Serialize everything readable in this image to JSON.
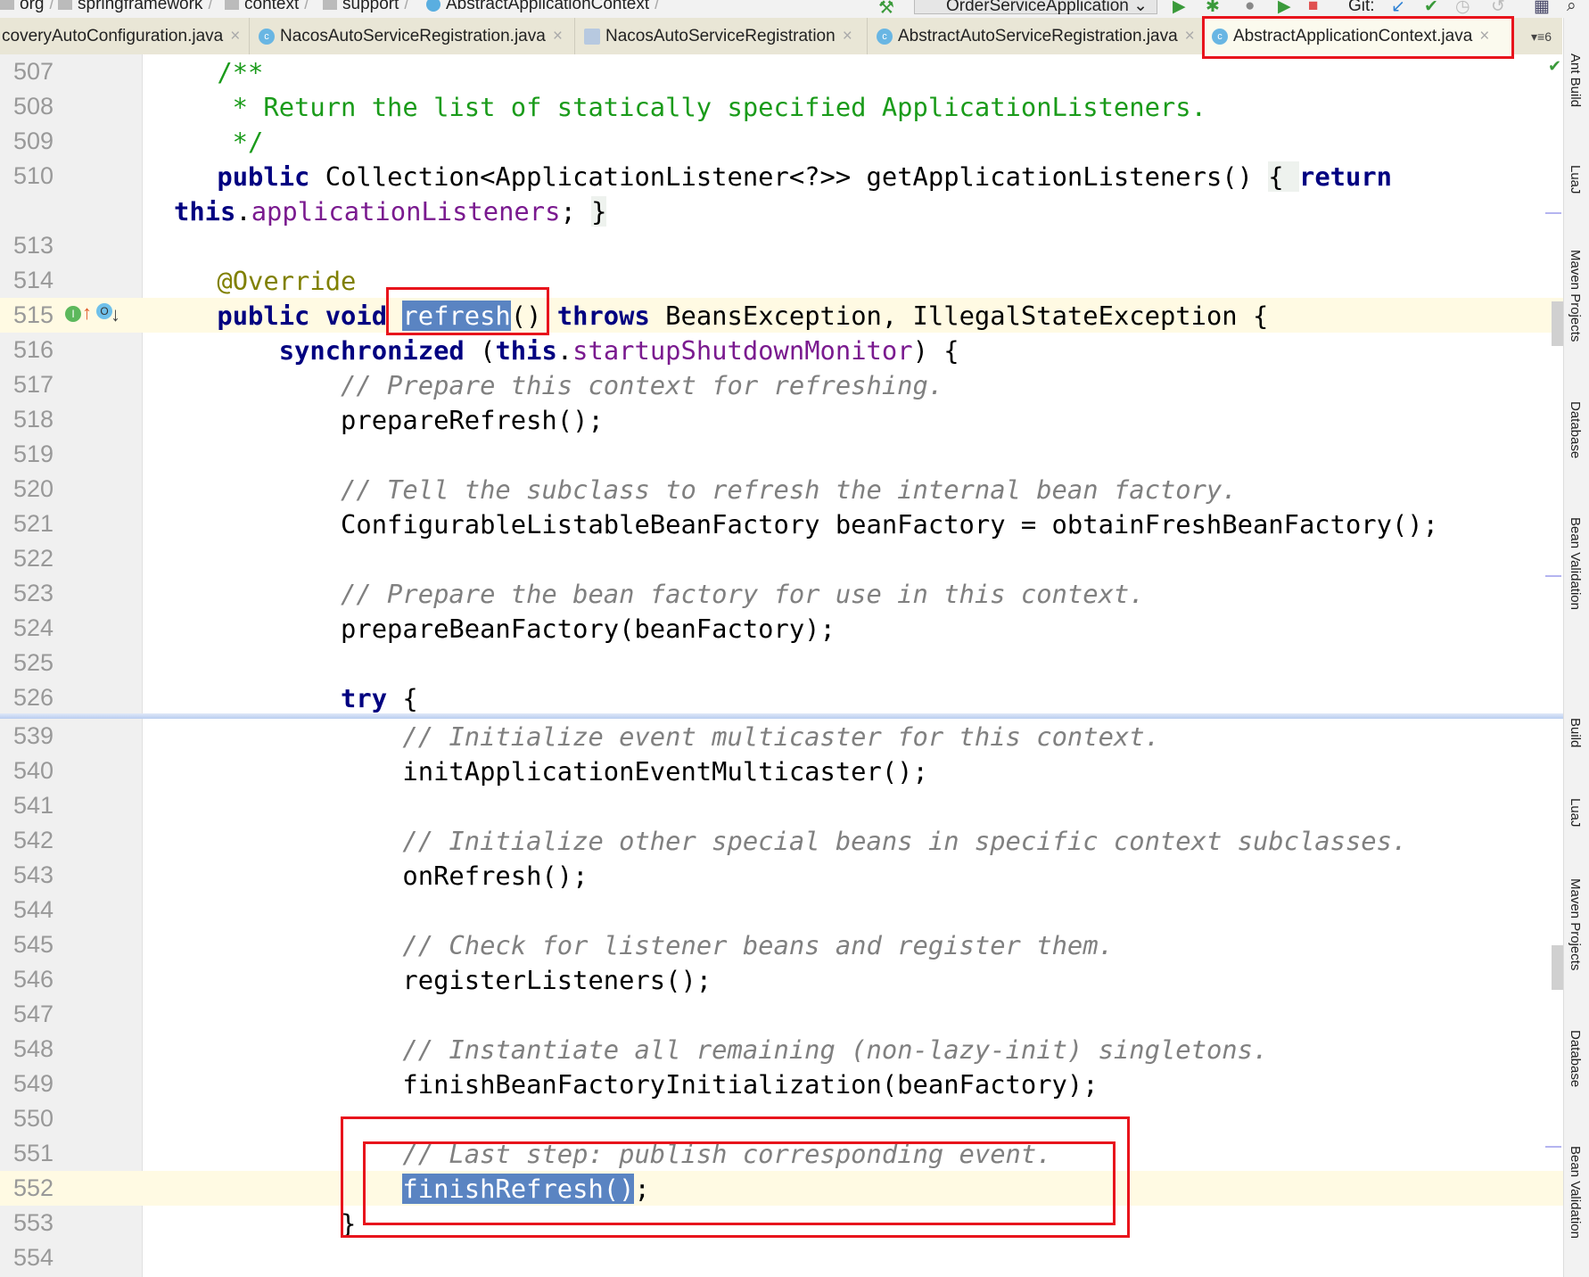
{
  "breadcrumb": [
    "org",
    "springframework",
    "context",
    "support",
    "AbstractApplicationContext"
  ],
  "toolbar": {
    "run_config": "OrderServiceApplication",
    "git_label": "Git:"
  },
  "tabs": [
    {
      "label": "coveryAutoConfiguration.java",
      "icon": "class-icon",
      "active": false
    },
    {
      "label": "NacosAutoServiceRegistration.java",
      "icon": "class-icon",
      "active": false
    },
    {
      "label": "NacosAutoServiceRegistration",
      "icon": "interface-diagram-icon",
      "active": false
    },
    {
      "label": "AbstractAutoServiceRegistration.java",
      "icon": "class-icon",
      "active": false
    },
    {
      "label": "AbstractApplicationContext.java",
      "icon": "class-icon",
      "active": true
    }
  ],
  "tab_overflow": "6",
  "right_tools": [
    "Ant Build",
    "LuaJ",
    "Maven Projects",
    "Database",
    "Bean Validation"
  ],
  "right_tools_lower": [
    "Build",
    "LuaJ",
    "Maven Projects",
    "Database",
    "Bean Validation"
  ],
  "pane1": [
    {
      "n": "507",
      "t": [
        [
          "p",
          "    "
        ],
        [
          "d",
          "/**"
        ]
      ]
    },
    {
      "n": "508",
      "t": [
        [
          "d",
          "     * Return the list of statically specified ApplicationListeners."
        ]
      ]
    },
    {
      "n": "509",
      "t": [
        [
          "d",
          "     */"
        ]
      ]
    },
    {
      "n": "510",
      "t": [
        [
          "p",
          "    "
        ],
        [
          "k",
          "public"
        ],
        [
          "p",
          " Collection<ApplicationListener<?>> getApplicationListeners() "
        ],
        [
          "fold",
          "{ "
        ],
        [
          "k",
          "return"
        ]
      ]
    },
    {
      "n": "",
      "wrap": true,
      "t": [
        [
          "k",
          "this"
        ],
        [
          "p",
          "."
        ],
        [
          "f",
          "applicationListeners"
        ],
        [
          "p",
          "; "
        ],
        [
          "fold",
          "}"
        ]
      ]
    },
    {
      "n": "513",
      "t": []
    },
    {
      "n": "514",
      "t": [
        [
          "p",
          "    "
        ],
        [
          "a",
          "@Override"
        ]
      ]
    },
    {
      "n": "515",
      "cur": true,
      "t": [
        [
          "p",
          "    "
        ],
        [
          "k",
          "public void "
        ],
        [
          "sel",
          "refresh"
        ],
        [
          "p",
          "() "
        ],
        [
          "k",
          "throws"
        ],
        [
          "p",
          " BeansException, IllegalStateException {"
        ]
      ]
    },
    {
      "n": "516",
      "t": [
        [
          "p",
          "        "
        ],
        [
          "k",
          "synchronized"
        ],
        [
          "p",
          " ("
        ],
        [
          "k",
          "this"
        ],
        [
          "p",
          "."
        ],
        [
          "f",
          "startupShutdownMonitor"
        ],
        [
          "p",
          ") {"
        ]
      ]
    },
    {
      "n": "517",
      "t": [
        [
          "p",
          "            "
        ],
        [
          "c",
          "// Prepare this context for refreshing."
        ]
      ]
    },
    {
      "n": "518",
      "t": [
        [
          "p",
          "            prepareRefresh();"
        ]
      ]
    },
    {
      "n": "519",
      "t": []
    },
    {
      "n": "520",
      "t": [
        [
          "p",
          "            "
        ],
        [
          "c",
          "// Tell the subclass to refresh the internal bean factory."
        ]
      ]
    },
    {
      "n": "521",
      "t": [
        [
          "p",
          "            ConfigurableListableBeanFactory beanFactory = obtainFreshBeanFactory();"
        ]
      ]
    },
    {
      "n": "522",
      "t": []
    },
    {
      "n": "523",
      "t": [
        [
          "p",
          "            "
        ],
        [
          "c",
          "// Prepare the bean factory for use in this context."
        ]
      ]
    },
    {
      "n": "524",
      "t": [
        [
          "p",
          "            prepareBeanFactory(beanFactory);"
        ]
      ]
    },
    {
      "n": "525",
      "t": []
    },
    {
      "n": "526",
      "t": [
        [
          "p",
          "            "
        ],
        [
          "k",
          "try"
        ],
        [
          "p",
          " {"
        ]
      ]
    }
  ],
  "pane2": [
    {
      "n": "539",
      "t": [
        [
          "p",
          "                "
        ],
        [
          "c",
          "// Initialize event multicaster for this context."
        ]
      ]
    },
    {
      "n": "540",
      "t": [
        [
          "p",
          "                initApplicationEventMulticaster();"
        ]
      ]
    },
    {
      "n": "541",
      "t": []
    },
    {
      "n": "542",
      "t": [
        [
          "p",
          "                "
        ],
        [
          "c",
          "// Initialize other special beans in specific context subclasses."
        ]
      ]
    },
    {
      "n": "543",
      "t": [
        [
          "p",
          "                onRefresh();"
        ]
      ]
    },
    {
      "n": "544",
      "t": []
    },
    {
      "n": "545",
      "t": [
        [
          "p",
          "                "
        ],
        [
          "c",
          "// Check for listener beans and register them."
        ]
      ]
    },
    {
      "n": "546",
      "t": [
        [
          "p",
          "                registerListeners();"
        ]
      ]
    },
    {
      "n": "547",
      "t": []
    },
    {
      "n": "548",
      "t": [
        [
          "p",
          "                "
        ],
        [
          "c",
          "// Instantiate all remaining (non-lazy-init) singletons."
        ]
      ]
    },
    {
      "n": "549",
      "t": [
        [
          "p",
          "                finishBeanFactoryInitialization(beanFactory);"
        ]
      ]
    },
    {
      "n": "550",
      "t": []
    },
    {
      "n": "551",
      "t": [
        [
          "p",
          "                "
        ],
        [
          "c",
          "// Last step: publish corresponding event."
        ]
      ]
    },
    {
      "n": "552",
      "cur": true,
      "t": [
        [
          "p",
          "                "
        ],
        [
          "sel",
          "finishRefresh()"
        ],
        [
          "p",
          ";"
        ]
      ]
    },
    {
      "n": "553",
      "t": [
        [
          "p",
          "            }"
        ]
      ]
    },
    {
      "n": "554",
      "t": []
    }
  ],
  "gutter_515": {
    "implements_badge": "I",
    "overrides_badge": "O"
  },
  "colors": {
    "keyword": "#000080",
    "comment": "#808080",
    "javadoc": "#1a9b1a",
    "field": "#7a1a8f",
    "annotation": "#808000",
    "selection": "#5a84c2",
    "highlight_box": "#e8141c",
    "current_line": "#fffae3"
  }
}
